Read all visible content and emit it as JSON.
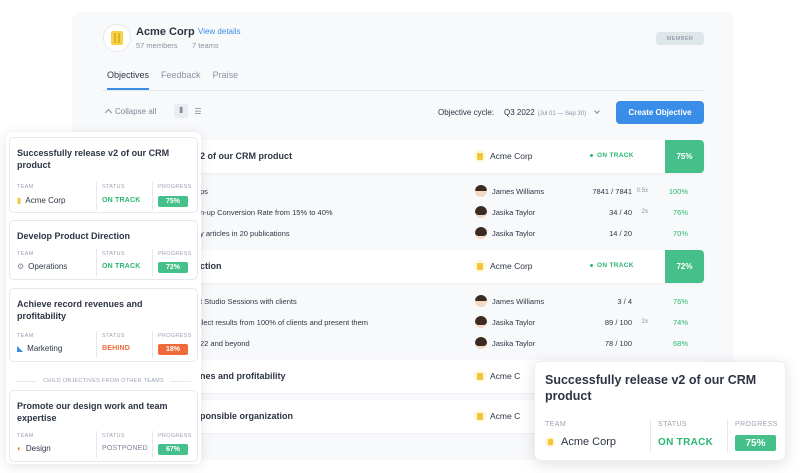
{
  "company": {
    "name": "Acme Corp",
    "view_details": "View details",
    "members": "57 members",
    "teams": "7 teams",
    "badge": "MEMBER"
  },
  "tabs": [
    "Objectives",
    "Feedback",
    "Praise"
  ],
  "toolbar": {
    "collapse_all": "Collapse all",
    "cycle_label": "Objective cycle:",
    "cycle_value": "Q3 2022",
    "cycle_range": "(Jul 01 — Sep 30)",
    "create_label": "Create Objective"
  },
  "objectives": [
    {
      "title": "2 of our CRM product",
      "team": "Acme Corp",
      "status": "ON TRACK",
      "progress": "75%",
      "key_results": [
        {
          "title": "ps",
          "owner": "James Williams",
          "value": "7841 / 7841",
          "mult": "0.5x",
          "pct": "100%"
        },
        {
          "title": "n-up Conversion Rate from 15% to 40%",
          "owner": "Jasika Taylor",
          "value": "34 / 40",
          "mult": "2x",
          "pct": "76%"
        },
        {
          "title": "y articles in 20 publications",
          "owner": "Jasika Taylor",
          "value": "14 / 20",
          "mult": "",
          "pct": "70%"
        }
      ]
    },
    {
      "title": "ction",
      "team": "Acme Corp",
      "status": "ON TRACK",
      "progress": "72%",
      "key_results": [
        {
          "title": "t Studio Sessions with clients",
          "owner": "James Williams",
          "value": "3 / 4",
          "mult": "",
          "pct": "76%"
        },
        {
          "title": "llect results from 100% of clients and present them",
          "owner": "Jasika Taylor",
          "value": "89 / 100",
          "mult": "2x",
          "pct": "74%"
        },
        {
          "title": "22 and beyond",
          "owner": "Jasika Taylor",
          "value": "78 / 100",
          "mult": "",
          "pct": "68%"
        }
      ]
    },
    {
      "title": "nes and profitability",
      "team": "Acme C"
    },
    {
      "title": "ponsible organization",
      "team": "Acme C"
    }
  ],
  "cards": [
    {
      "title": "Successfully release v2 of our CRM product",
      "team_icon": "acme-logo",
      "team": "Acme Corp",
      "status": "ON TRACK",
      "progress": "75%",
      "color": "#45c08a"
    },
    {
      "title": "Develop Product Direction",
      "team_icon": "gear-icon",
      "team": "Operations",
      "status": "ON TRACK",
      "progress": "72%",
      "color": "#45c08a"
    },
    {
      "title": "Achieve record revenues and profitability",
      "team_icon": "megaphone-icon",
      "team": "Marketing",
      "status": "BEHIND",
      "progress": "18%",
      "color": "#ef6a3a"
    },
    {
      "title": "Promote our design work and team expertise",
      "team_icon": "palette-icon",
      "team": "Design",
      "status": "POSTPONED",
      "progress": "67%",
      "color": "#45c08a"
    }
  ],
  "card_headers": {
    "team": "TEAM",
    "status": "STATUS",
    "progress": "PROGRESS"
  },
  "child_separator": "CHILD OBJECTIVES FROM OTHER TEAMS",
  "big_card": {
    "title": "Successfully release v2 of our CRM product",
    "team": "Acme Corp",
    "status": "ON TRACK",
    "progress": "75%"
  },
  "colors": {
    "accent": "#3b8ee8",
    "on_track": "#2bb673",
    "progress_fill": "#45c08a",
    "behind": "#ef6a3a"
  }
}
